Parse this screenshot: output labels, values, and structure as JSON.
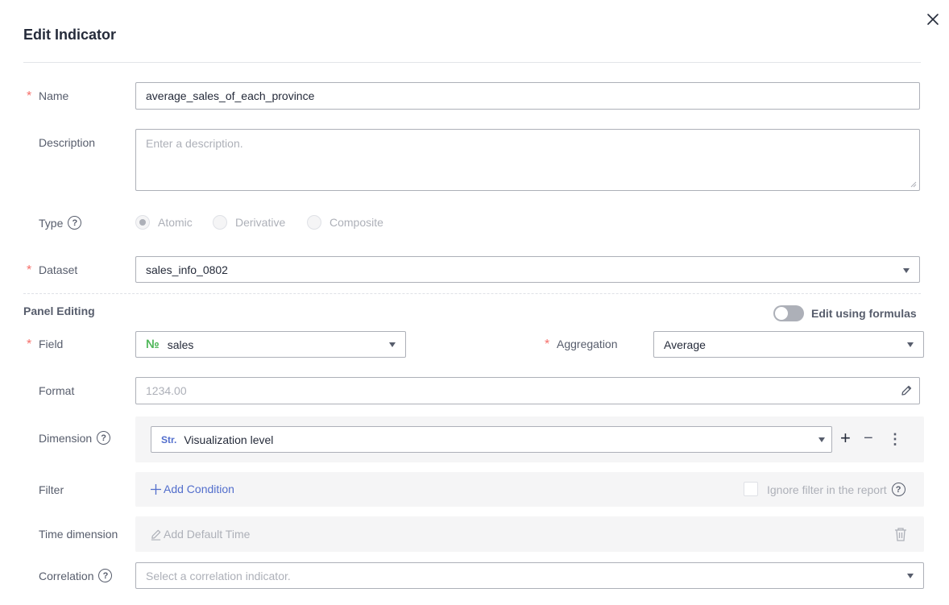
{
  "dialog": {
    "title": "Edit Indicator",
    "close_icon": "close-icon"
  },
  "form": {
    "name": {
      "label": "Name",
      "required": "*",
      "value": "average_sales_of_each_province"
    },
    "description": {
      "label": "Description",
      "placeholder": "Enter a description."
    },
    "type": {
      "label": "Type",
      "help": "?",
      "options": [
        {
          "label": "Atomic",
          "checked": true
        },
        {
          "label": "Derivative",
          "checked": false
        },
        {
          "label": "Composite",
          "checked": false
        }
      ]
    },
    "dataset": {
      "label": "Dataset",
      "required": "*",
      "value": "sales_info_0802"
    }
  },
  "panel_editing": {
    "title": "Panel Editing",
    "toggle_label": "Edit using formulas",
    "toggle_on": false,
    "field": {
      "label": "Field",
      "required": "*",
      "type_badge": "№",
      "value": "sales"
    },
    "aggregation": {
      "label": "Aggregation",
      "required": "*",
      "value": "Average"
    },
    "format": {
      "label": "Format",
      "placeholder": "1234.00",
      "icon": "pencil-icon"
    },
    "dimension": {
      "label": "Dimension",
      "help": "?",
      "type_badge": "Str.",
      "value": "Visualization level",
      "add": "+",
      "remove": "−",
      "more": "⋮"
    },
    "filter": {
      "label": "Filter",
      "add_label": "Add Condition",
      "ignore_label": "Ignore filter in the report",
      "help": "?"
    },
    "time_dimension": {
      "label": "Time dimension",
      "add_label": "Add Default Time",
      "icon": "trash-icon"
    },
    "correlation": {
      "label": "Correlation",
      "help": "?",
      "placeholder": "Select a correlation indicator."
    }
  },
  "colors": {
    "accent": "#526ecc",
    "required": "#f66f6a",
    "number_badge": "#50b85a",
    "border": "#adb0b8",
    "panel_bg": "#f5f5f6"
  }
}
